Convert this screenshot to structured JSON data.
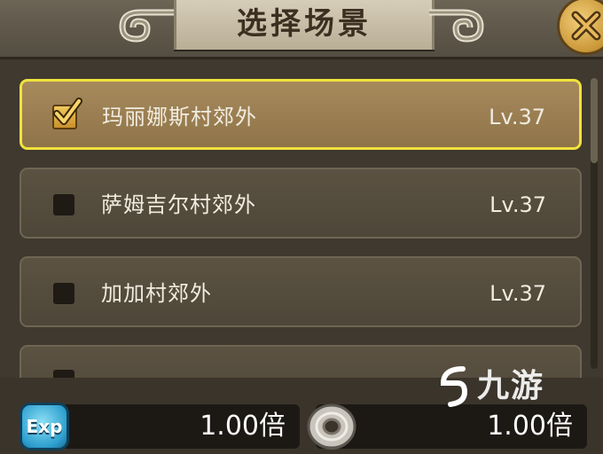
{
  "header": {
    "title": "选择场景"
  },
  "scenes": [
    {
      "name": "玛丽娜斯村郊外",
      "level": "Lv.37",
      "selected": true
    },
    {
      "name": "萨姆吉尔村郊外",
      "level": "Lv.37",
      "selected": false
    },
    {
      "name": "加加村郊外",
      "level": "Lv.37",
      "selected": false
    }
  ],
  "bottom": {
    "exp_icon_text": "Exp",
    "exp_multiplier": "1.00倍",
    "coin_multiplier": "1.00倍"
  },
  "watermark": {
    "text": "九游"
  },
  "colors": {
    "selected_border": "#f1e23c",
    "accent_gold": "#d9a640"
  },
  "icons": [
    "close-icon",
    "check-icon",
    "exp-icon",
    "coin-icon",
    "watermark-logo-icon"
  ]
}
